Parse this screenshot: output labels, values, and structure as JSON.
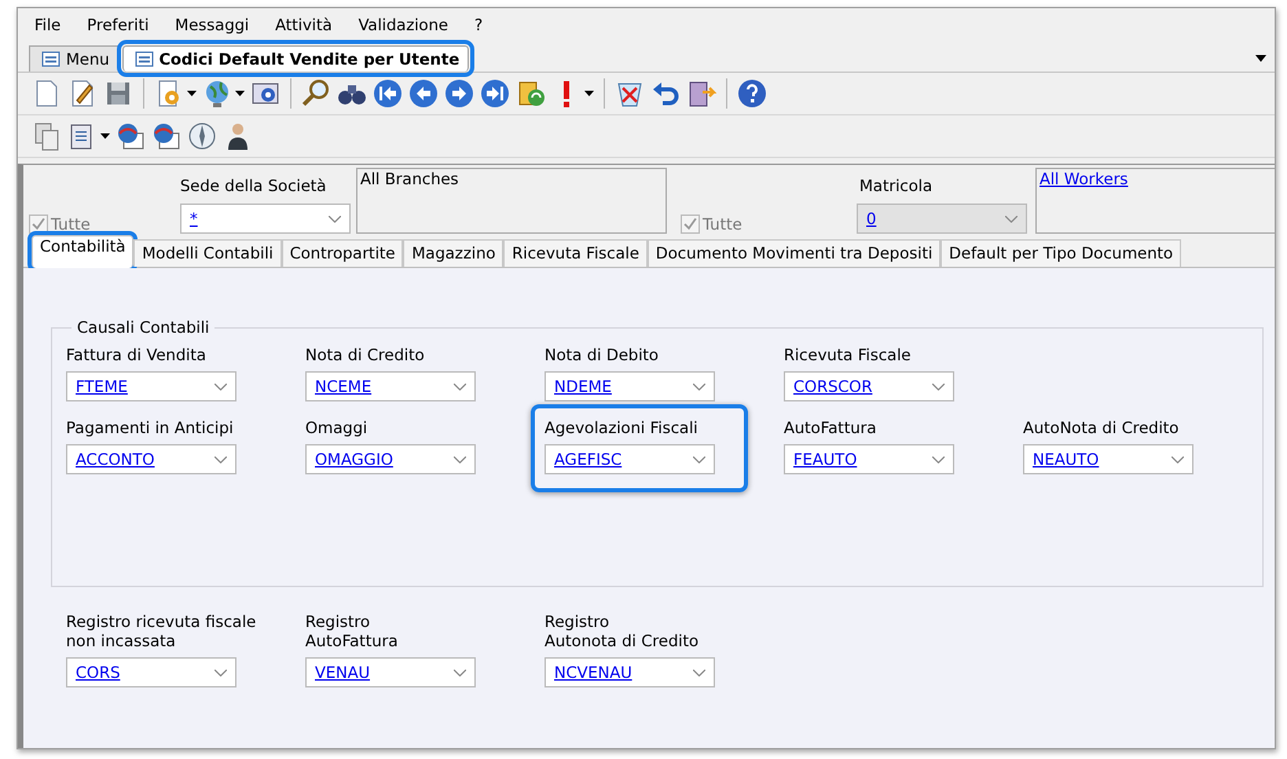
{
  "menu": [
    "File",
    "Preferiti",
    "Messaggi",
    "Attività",
    "Validazione",
    "?"
  ],
  "doc_tabs": [
    {
      "label": "Menu",
      "selected": false,
      "highlighted": false
    },
    {
      "label": "Codici Default Vendite per Utente",
      "selected": true,
      "highlighted": true
    }
  ],
  "filters": {
    "branch": {
      "all_label": "Tutte",
      "all_checked": true,
      "label": "Sede della Società",
      "value": "*",
      "list_text": "All Branches"
    },
    "worker": {
      "all_label": "Tutte",
      "all_checked": true,
      "label": "Matricola",
      "value": "0",
      "disabled": true,
      "link": "All Workers"
    }
  },
  "section_tabs": [
    {
      "label": "Contabilità",
      "selected": true,
      "highlighted": true
    },
    {
      "label": "Modelli Contabili",
      "selected": false,
      "highlighted": false
    },
    {
      "label": "Contropartite",
      "selected": false,
      "highlighted": false
    },
    {
      "label": "Magazzino",
      "selected": false,
      "highlighted": false
    },
    {
      "label": "Ricevuta Fiscale",
      "selected": false,
      "highlighted": false
    },
    {
      "label": "Documento Movimenti tra Depositi",
      "selected": false,
      "highlighted": false
    },
    {
      "label": "Default per Tipo Documento",
      "selected": false,
      "highlighted": false
    }
  ],
  "group": {
    "title": "Causali Contabili",
    "rows": [
      [
        {
          "label": "Fattura di Vendita",
          "value": "FTEME",
          "highlighted": false
        },
        {
          "label": "Nota di Credito",
          "value": "NCEME",
          "highlighted": false
        },
        {
          "label": "Nota di Debito",
          "value": "NDEME",
          "highlighted": false
        },
        {
          "label": "Ricevuta Fiscale",
          "value": "CORSCOR",
          "highlighted": false
        }
      ],
      [
        {
          "label": "Pagamenti in Anticipi",
          "value": "ACCONTO",
          "highlighted": false
        },
        {
          "label": "Omaggi",
          "value": "OMAGGIO",
          "highlighted": false
        },
        {
          "label": "Agevolazioni Fiscali",
          "value": "AGEFISC",
          "highlighted": true
        },
        {
          "label": "AutoFattura",
          "value": "FEAUTO",
          "highlighted": false
        },
        {
          "label": "AutoNota di Credito",
          "value": "NEAUTO",
          "highlighted": false
        }
      ]
    ]
  },
  "extra_fields": [
    {
      "label_lines": [
        "Registro ricevuta fiscale",
        "non incassata"
      ],
      "value": "CORS",
      "highlighted": false
    },
    {
      "label_lines": [
        "Registro",
        "AutoFattura"
      ],
      "value": "VENAU",
      "highlighted": false
    },
    {
      "label_lines": [
        "Registro",
        "Autonota di Credito"
      ],
      "value": "NCVENAU",
      "highlighted": false
    }
  ]
}
